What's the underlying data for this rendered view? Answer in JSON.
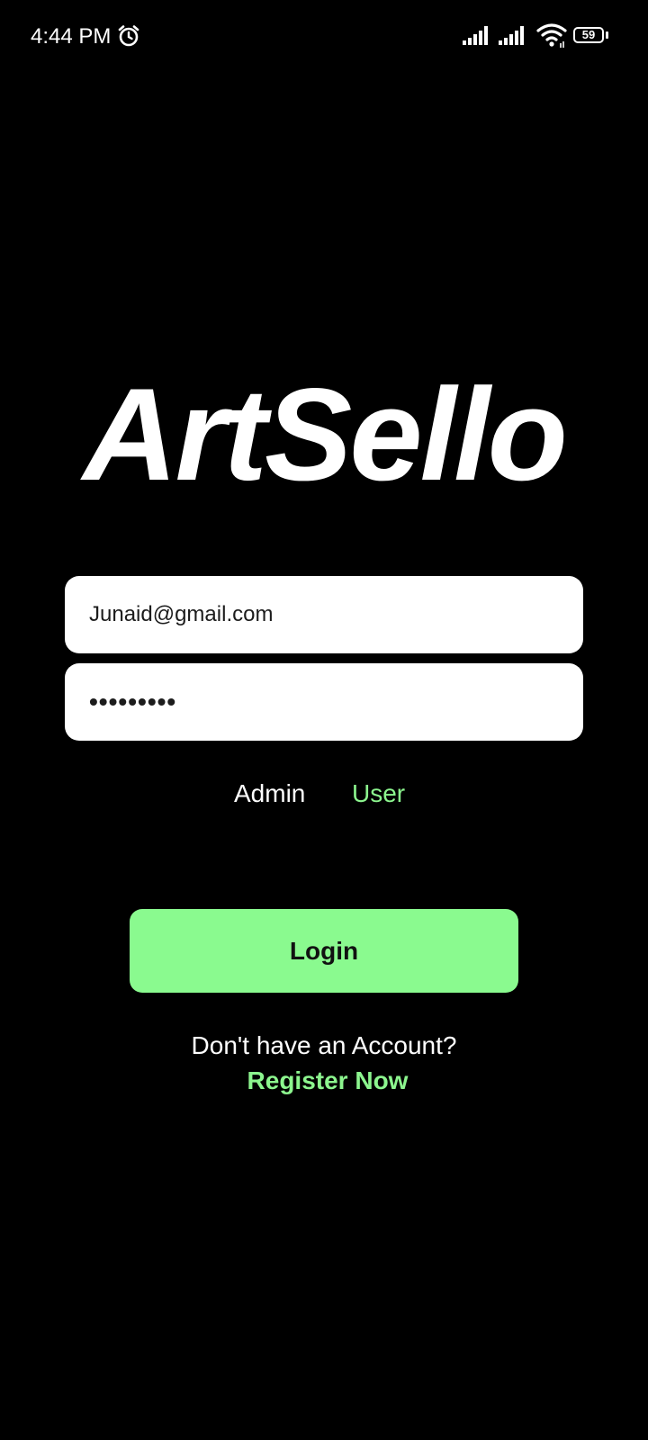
{
  "status_bar": {
    "time": "4:44 PM",
    "battery_level": "59",
    "icons": [
      "alarm-icon",
      "signal-icon",
      "signal-icon",
      "wifi-icon",
      "battery-icon"
    ]
  },
  "app": {
    "logo_text": "ArtSello"
  },
  "login_form": {
    "email_value": "Junaid@gmail.com",
    "password_value": "•••••••••",
    "role_admin_label": "Admin",
    "role_user_label": "User",
    "selected_role": "User",
    "login_label": "Login"
  },
  "footer": {
    "no_account_text": "Don't have an Account?",
    "register_label": "Register Now"
  },
  "colors": {
    "background": "#000000",
    "accent_green": "#8afa8f",
    "field_background": "#ffffff",
    "text_primary": "#ffffff"
  }
}
